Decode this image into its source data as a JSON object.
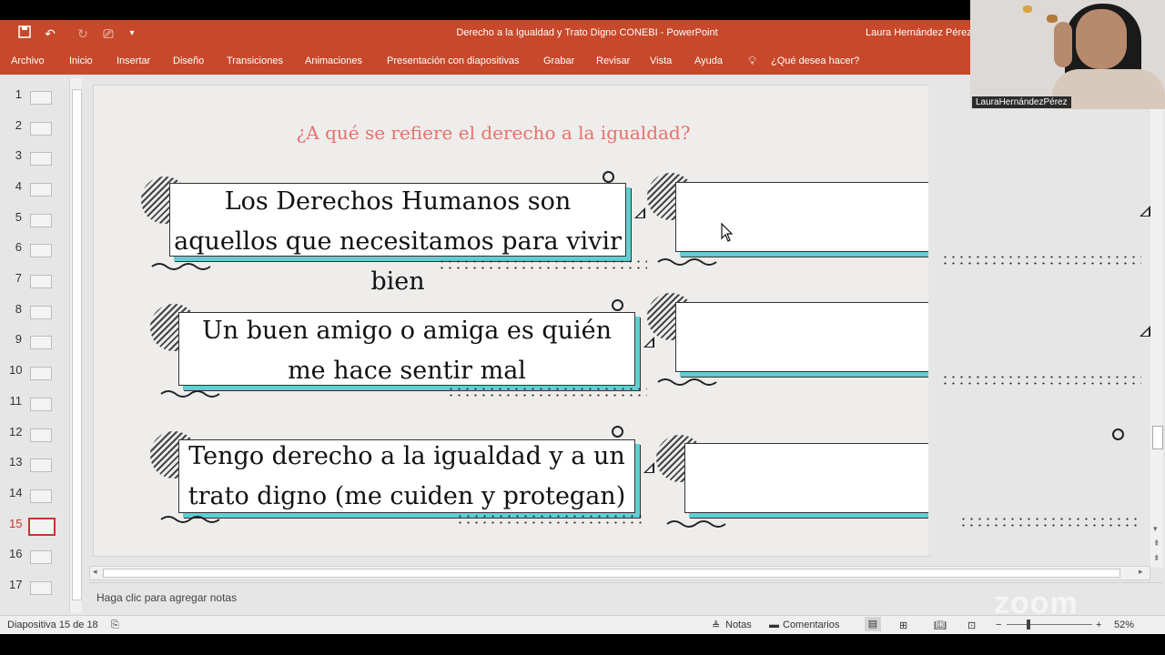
{
  "window": {
    "title": "Derecho a la Igualdad y Trato Digno CONEBI  -  PowerPoint",
    "user": "Laura Hernández Pérez"
  },
  "ribbon": {
    "tabs": [
      "Archivo",
      "Inicio",
      "Insertar",
      "Diseño",
      "Transiciones",
      "Animaciones",
      "Presentación con diapositivas",
      "Grabar",
      "Revisar",
      "Vista",
      "Ayuda"
    ],
    "tell_me": "¿Qué desea hacer?"
  },
  "thumbnails": {
    "numbers": [
      "1",
      "2",
      "3",
      "4",
      "5",
      "6",
      "7",
      "8",
      "9",
      "10",
      "11",
      "12",
      "13",
      "14",
      "15",
      "16",
      "17"
    ],
    "selected": "15"
  },
  "slide": {
    "title": "¿A qué se refiere el derecho a la igualdad?",
    "cards": [
      "Los Derechos Humanos son aquellos que necesitamos para vivir bien",
      "Un buen amigo o amiga es quién  me hace sentir mal",
      "Tengo derecho a la igualdad y a un trato digno (me cuiden y protegan)"
    ],
    "colors": {
      "title": "#e8706d",
      "accent": "#5fcfd3",
      "ribbon": "#c7482a"
    }
  },
  "notes": {
    "placeholder": "Haga clic para agregar notas"
  },
  "status": {
    "slide_counter": "Diapositiva 15 de 18",
    "notes_btn": "Notas",
    "comments_btn": "Comentarios",
    "zoom": "52%"
  },
  "webcam": {
    "label": "LauraHernándezPérez"
  },
  "watermark": "zoom"
}
